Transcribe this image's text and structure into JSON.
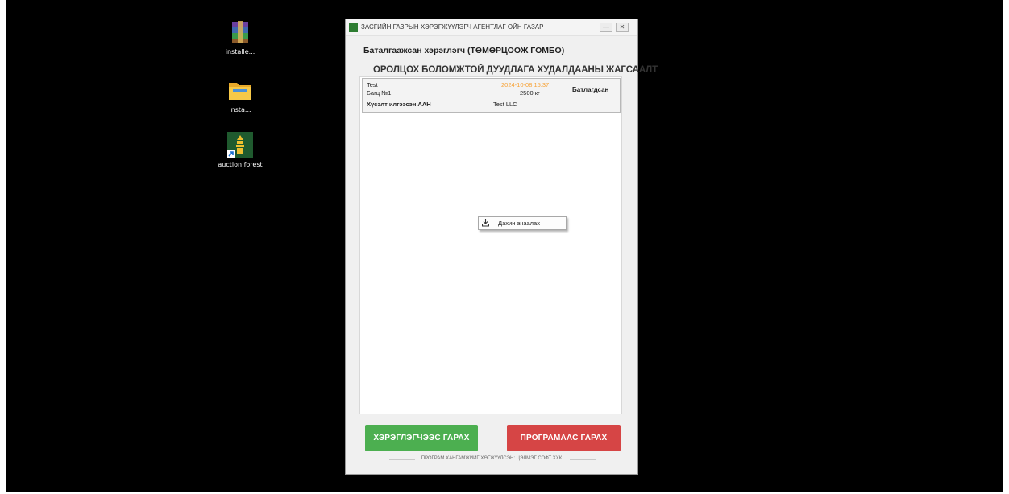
{
  "desktop": {
    "icons": [
      {
        "name": "winrar-icon",
        "label": "installe..."
      },
      {
        "name": "folder-icon",
        "label": "insta..."
      },
      {
        "name": "auction-app-icon",
        "label": "auction forest"
      }
    ]
  },
  "window": {
    "title": "ЗАСГИЙН ГАЗРЫН ХЭРЭГЖҮҮЛЭГЧ АГЕНТЛАГ ОЙН ГАЗАР",
    "minimize": "—",
    "close": "✕",
    "user_line": "Баталгаажсан хэрэглэгч (ТӨМӨРЦООЖ ГОМБО)",
    "list_heading": "ОРОЛЦОХ БОЛОМЖТОЙ ДУУДЛАГА ХУДАЛДААНЫ ЖАГСААЛТ",
    "auction": {
      "name": "Test",
      "batch": "Багц №1",
      "datetime": "2024-10-08 15:37",
      "weight": "2500 кг",
      "status": "Батлагдсан",
      "requester_label": "Хүсэлт илгээсэн ААН",
      "company": "Test LLC"
    },
    "context_menu": {
      "icon": "download-icon",
      "label": "Дахин ачаалах"
    },
    "logout_button": "ХЭРЭГЛЭГЧЭЭС ГАРАХ",
    "exit_button": "ПРОГРАМААС ГАРАХ",
    "footer": "ПРОГРАМ ХАНГАМЖИЙГ ХӨГЖҮҮЛСЭН: ЦЭЛМЭГ СОФТ ХХК"
  },
  "colors": {
    "logout_green": "#4caf50",
    "exit_red": "#d64545",
    "date_orange": "#f7a235",
    "desktop_bg": "#000000"
  }
}
